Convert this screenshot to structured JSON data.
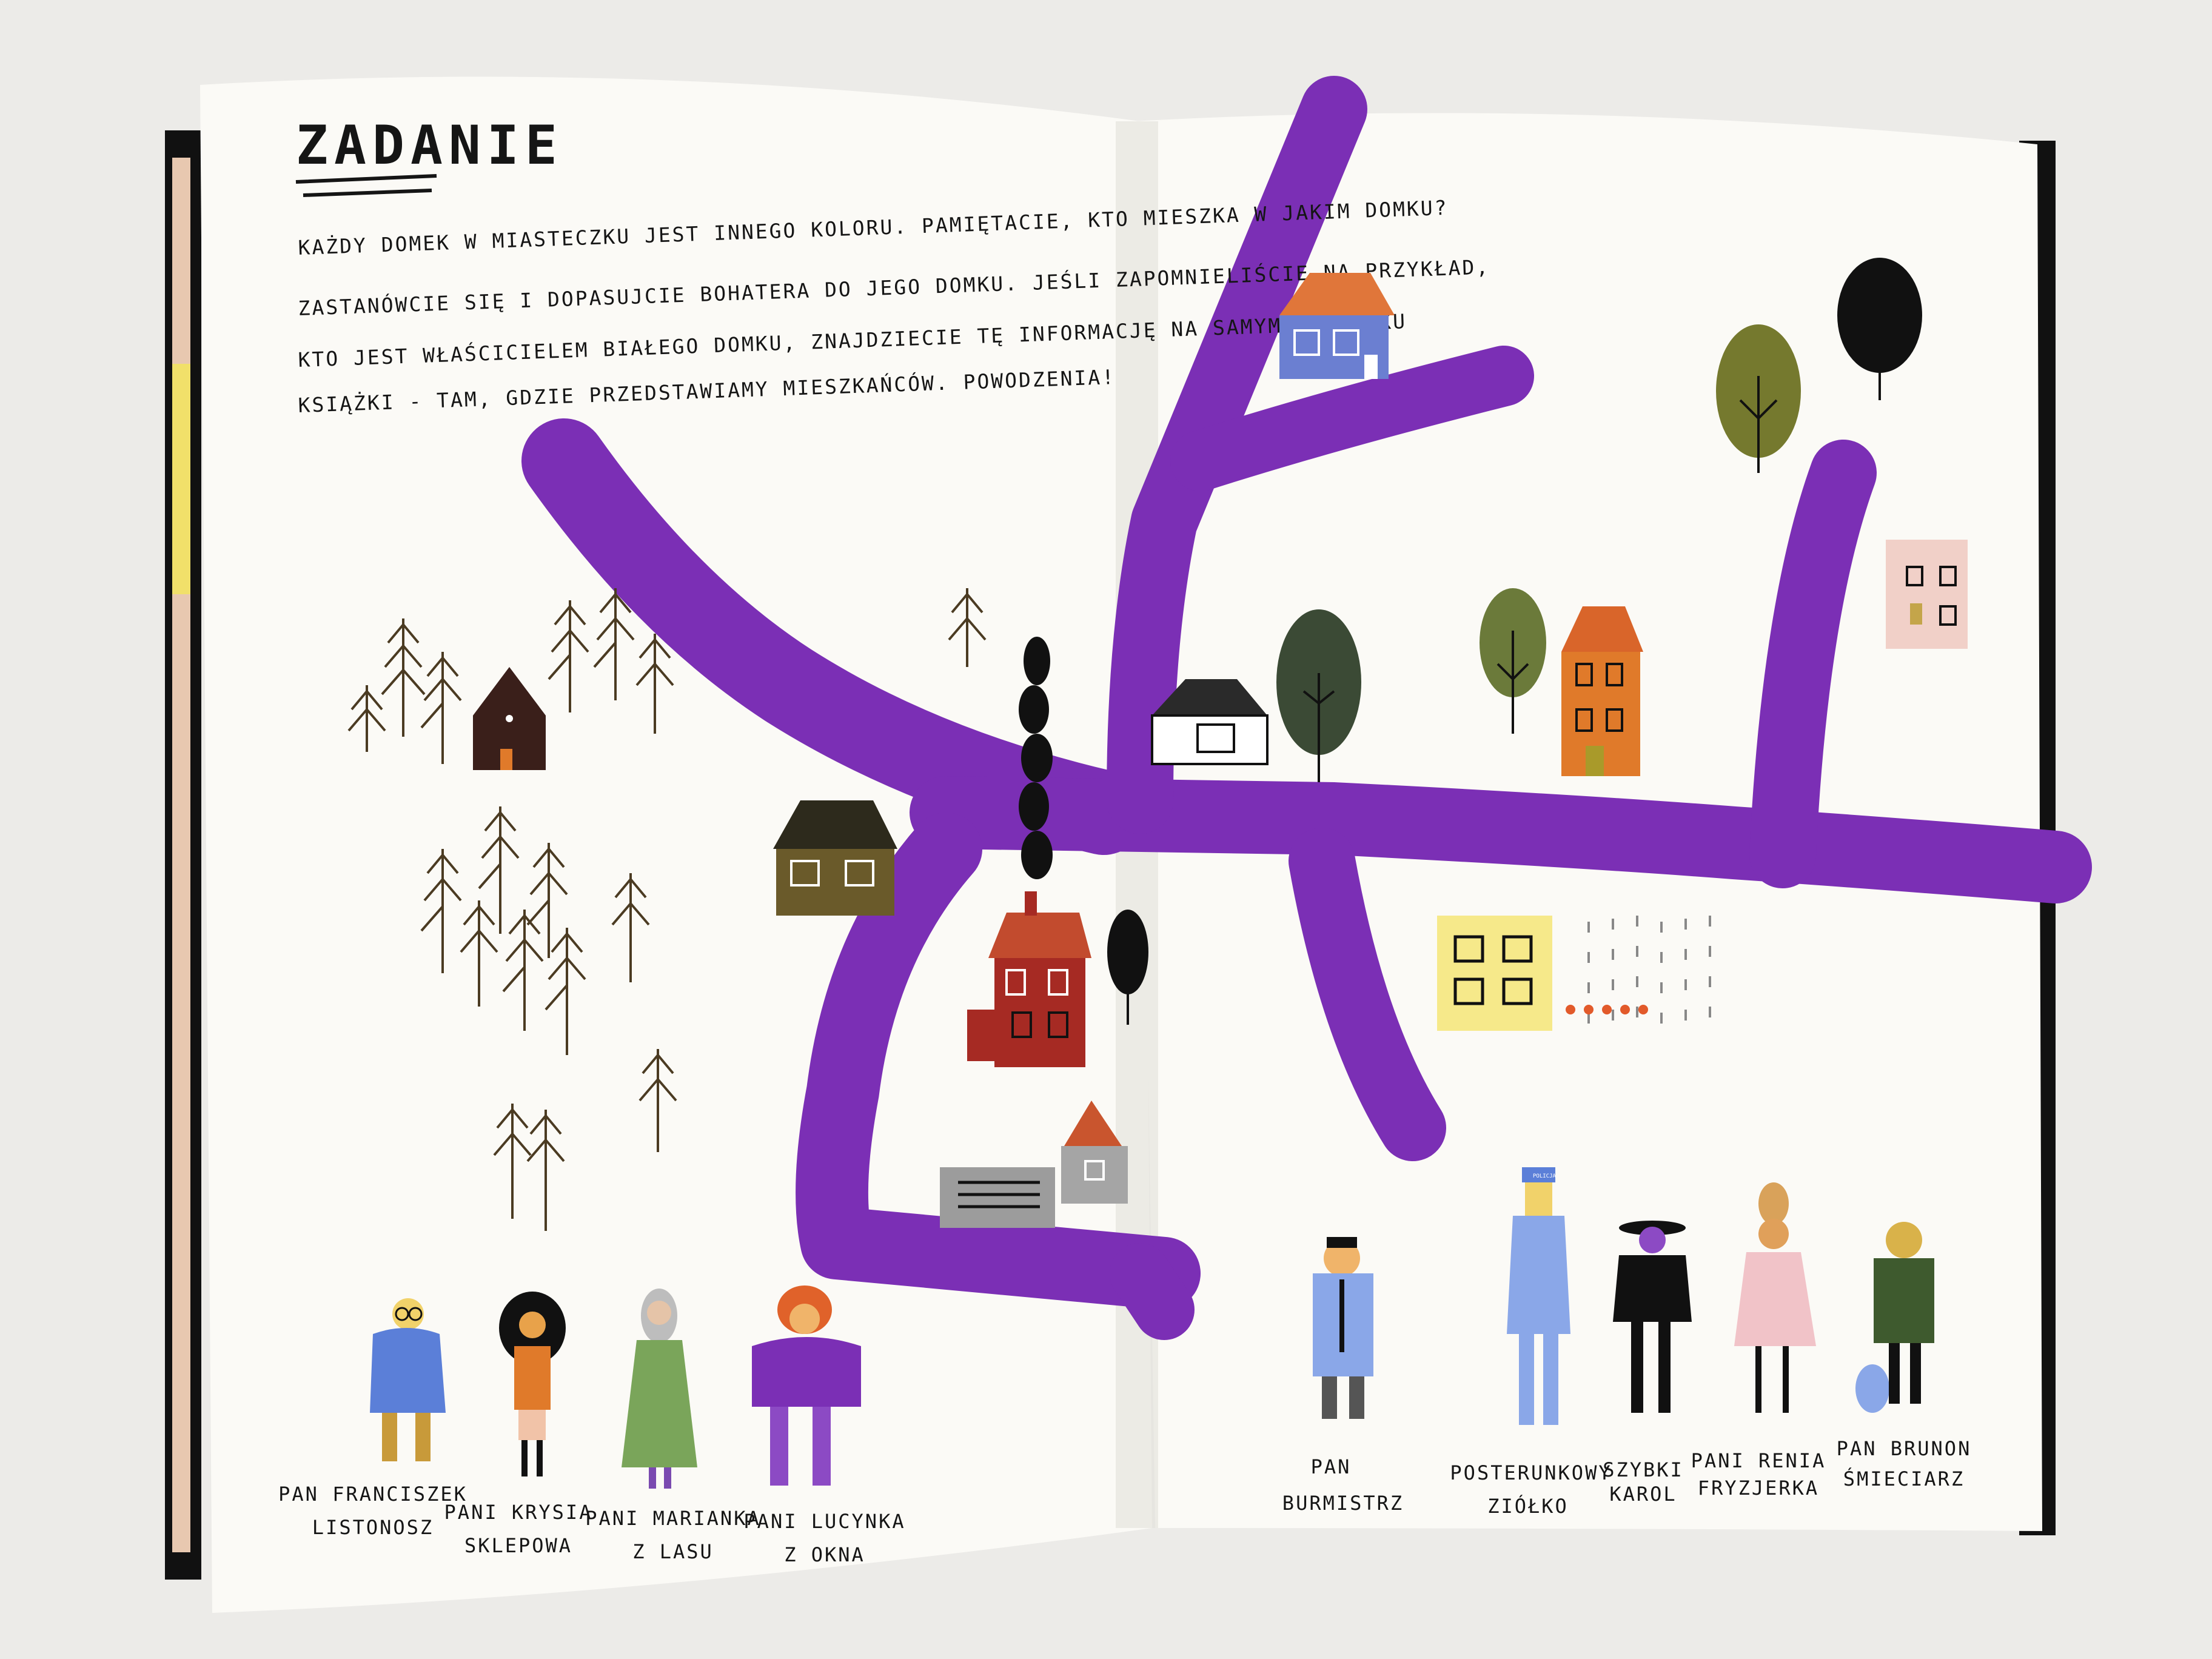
{
  "left_page": {
    "title": "ZADANIE",
    "paragraph_lines": [
      "KAŻDY DOMEK W MIASTECZKU JEST INNEGO KOLORU. PAMIĘTACIE, KTO MIESZKA W JAKIM DOMKU?",
      "ZASTANÓWCIE SIĘ I DOPASUJCIE BOHATERA DO JEGO DOMKU. JEŚLI ZAPOMNIELIŚCIE NA PRZYKŁAD,",
      "KTO JEST WŁAŚCICIELEM BIAŁEGO DOMKU,  ZNAJDZIECIE TĘ INFORMACJĘ NA SAMYM POCZĄTKU",
      "KSIĄŻKI - TAM, GDZIE PRZEDSTAWIAMY MIESZKAŃCÓW. POWODZENIA!"
    ],
    "characters": [
      {
        "line1": "PAN FRANCISZEK",
        "line2": "LISTONOSZ"
      },
      {
        "line1": "PANI KRYSIA",
        "line2": "SKLEPOWA"
      },
      {
        "line1": "PANI MARIANKA",
        "line2": "Z LASU"
      },
      {
        "line1": "PANI LUCYNKA",
        "line2": "Z OKNA"
      }
    ]
  },
  "right_page": {
    "characters": [
      {
        "line1": "PAN",
        "line2": "BURMISTRZ"
      },
      {
        "line1": "POSTERUNKOWY",
        "line2": "ZIÓŁKO"
      },
      {
        "line1": "SZYBKI",
        "line2": "KAROL"
      },
      {
        "line1": "PANI RENIA",
        "line2": "FRYZJERKA"
      },
      {
        "line1": "PAN BRUNON",
        "line2": "ŚMIECIARZ"
      }
    ],
    "cap_badge": "POLICJA"
  },
  "colors": {
    "road": "#7b2fb5",
    "paper": "#fbfaf6",
    "background": "#ecebe8"
  }
}
